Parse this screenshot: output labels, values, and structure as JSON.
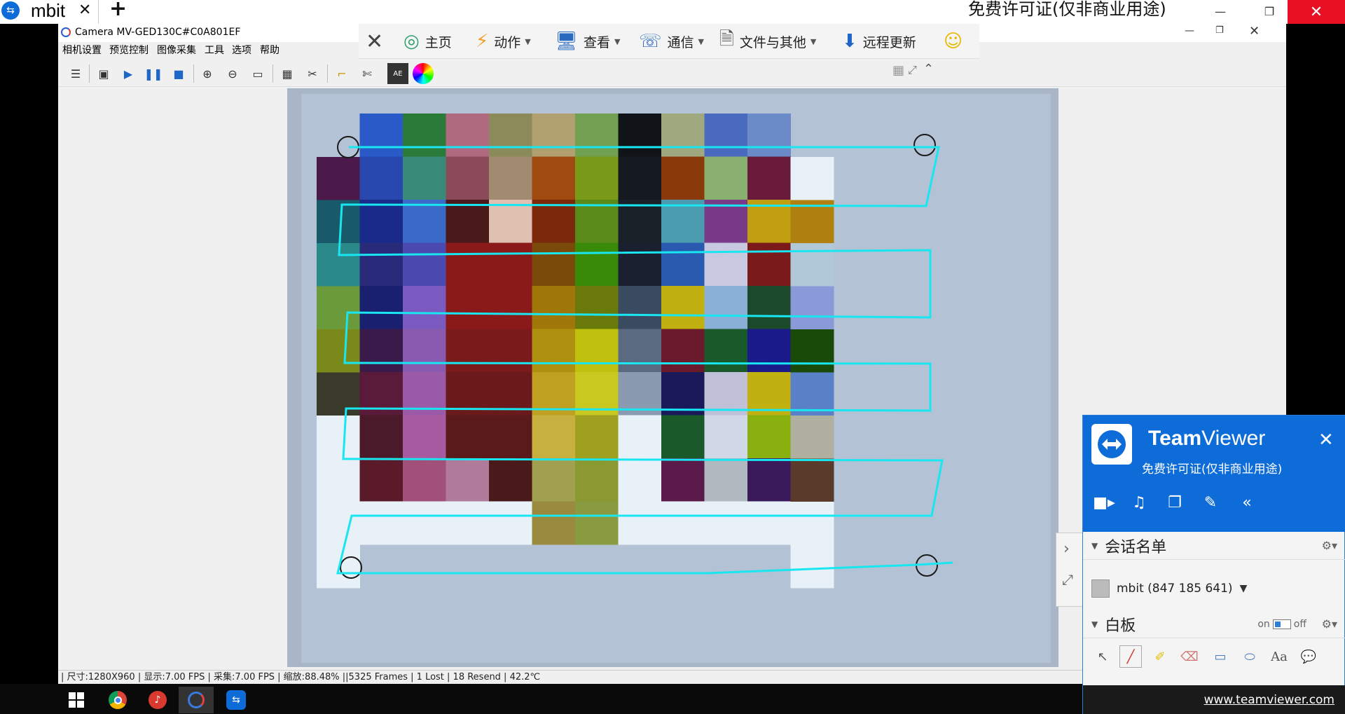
{
  "outer": {
    "tab_title": "mbit",
    "tab_close": "✕",
    "tab_add": "+",
    "license_text": "免费许可证(仅非商业用途)"
  },
  "camera": {
    "window_title": "Camera MV-GED130C#C0A801EF",
    "menu": [
      "相机设置",
      "预览控制",
      "图像采集",
      "工具",
      "选项",
      "帮助"
    ],
    "status_bar": "| 尺寸:1280X960 | 显示:7.00 FPS | 采集:7.00 FPS | 缩放:88.48% ||5325 Frames | 1 Lost | 18 Resend | 42.2℃"
  },
  "tv_toolbar": {
    "items": [
      "主页",
      "动作",
      "查看",
      "通信",
      "文件与其他",
      "远程更新"
    ]
  },
  "tv_panel": {
    "brand_bold": "Team",
    "brand_rest": "Viewer",
    "license": "免费许可证(仅非商业用途)",
    "session_header": "会话名单",
    "session_entry": "mbit (847 185 641)",
    "whiteboard_header": "白板",
    "wb_on": "on",
    "wb_off": "off",
    "text_tool": "Aa",
    "footer_url": "www.teamviewer.com"
  },
  "chart_colors": {
    "cyan_stroke": "#18e6f0",
    "teamviewer_blue": "#0e6cd8"
  }
}
